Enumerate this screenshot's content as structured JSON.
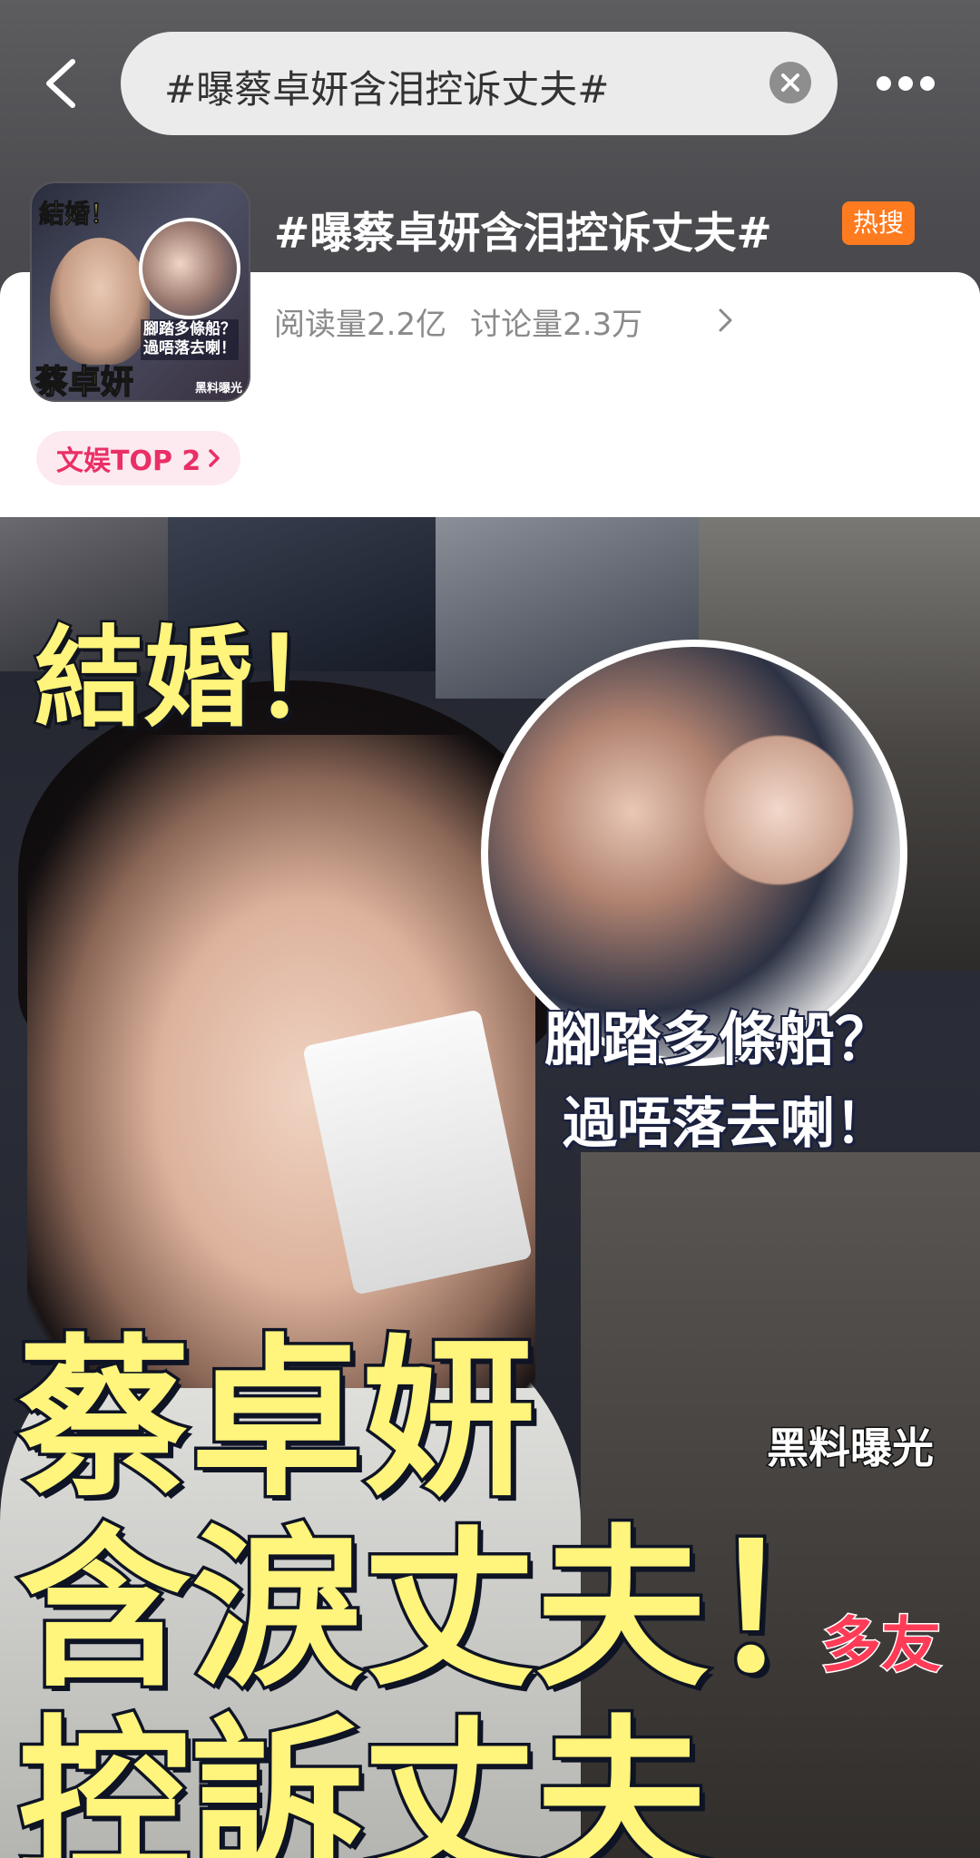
{
  "search": {
    "query": "#曝蔡卓妍含泪控诉丈夫#"
  },
  "topic": {
    "title": "#曝蔡卓妍含泪控诉丈夫#",
    "hot_badge": "热搜",
    "read_count": "阅读量2.2亿",
    "discuss_count": "讨论量2.3万",
    "rank_label": "文娱TOP 2"
  },
  "thumbnail": {
    "caption_marry": "結婚！",
    "caption_boat": "腳踏多條船？",
    "caption_cross": "過唔落去喇！",
    "caption_name": "蔡卓妍",
    "caption_expose": "黑料曝光"
  },
  "image": {
    "caption_marry": "結婚！",
    "caption_boat": "腳踏多條船？",
    "caption_cross": "過唔落去喇！",
    "caption_expose": "黑料曝光",
    "caption_name": "蔡卓妍",
    "caption_tears": "含淚丈夫！",
    "caption_accuse": "控訴丈夫",
    "caption_friends": "多友"
  },
  "colors": {
    "hot_badge": "#ff7b1f",
    "rank_text": "#ea2f66",
    "caption_yellow": "#fff47c"
  },
  "icons": {
    "back": "chevron-left-icon",
    "clear": "close-circle-icon",
    "more": "more-horizontal-icon",
    "stats_arrow": "chevron-right-icon",
    "rank_arrow": "chevron-right-icon"
  }
}
